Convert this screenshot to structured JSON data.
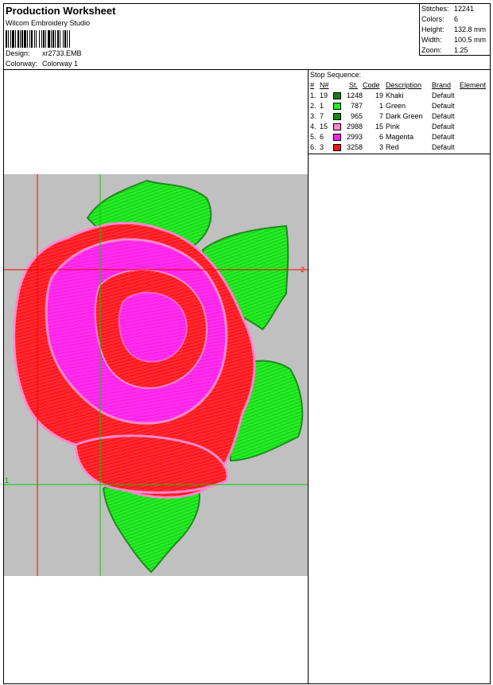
{
  "header": {
    "title": "Production Worksheet",
    "software": "Wilcom Embroidery Studio",
    "design_label": "Design:",
    "design_value": "xr2733.EMB",
    "colorway_label": "Colorway:",
    "colorway_value": "Colorway 1"
  },
  "stats": {
    "stitches_label": "Stitches:",
    "stitches": "12241",
    "colors_label": "Colors:",
    "colors": "6",
    "height_label": "Height:",
    "height": "132.8 mm",
    "width_label": "Width:",
    "width": "100.5 mm",
    "zoom_label": "Zoom:",
    "zoom": "1.25"
  },
  "stop_sequence": {
    "title": "Stop Sequence:",
    "headers": {
      "idx": "#",
      "n": "N#",
      "st": "St.",
      "code": "Code",
      "desc": "Description",
      "brand": "Brand",
      "element": "Element"
    },
    "rows": [
      {
        "idx": "1.",
        "n": "19",
        "st": "1248",
        "code": "19",
        "desc": "Khaki",
        "brand": "Default",
        "color": "#1f7a1f"
      },
      {
        "idx": "2.",
        "n": "1",
        "st": "787",
        "code": "1",
        "desc": "Green",
        "brand": "Default",
        "color": "#22ee22"
      },
      {
        "idx": "3.",
        "n": "7",
        "st": "965",
        "code": "7",
        "desc": "Dark Green",
        "brand": "Default",
        "color": "#138a13"
      },
      {
        "idx": "4.",
        "n": "15",
        "st": "2988",
        "code": "15",
        "desc": "Pink",
        "brand": "Default",
        "color": "#ff88cc"
      },
      {
        "idx": "5.",
        "n": "6",
        "st": "2993",
        "code": "6",
        "desc": "Magenta",
        "brand": "Default",
        "color": "#ff22ee"
      },
      {
        "idx": "6.",
        "n": "3",
        "st": "3258",
        "code": "3",
        "desc": "Red",
        "brand": "Default",
        "color": "#ff1111"
      }
    ]
  },
  "design": {
    "marker_2": "2",
    "marker_1": "1",
    "colors": {
      "background": "#c0c0c0",
      "leaf": "#22ee22",
      "leaf_dark": "#1f8a1f",
      "red": "#ff1a1a",
      "magenta": "#ff22ee",
      "pink": "#ff88cc"
    }
  }
}
